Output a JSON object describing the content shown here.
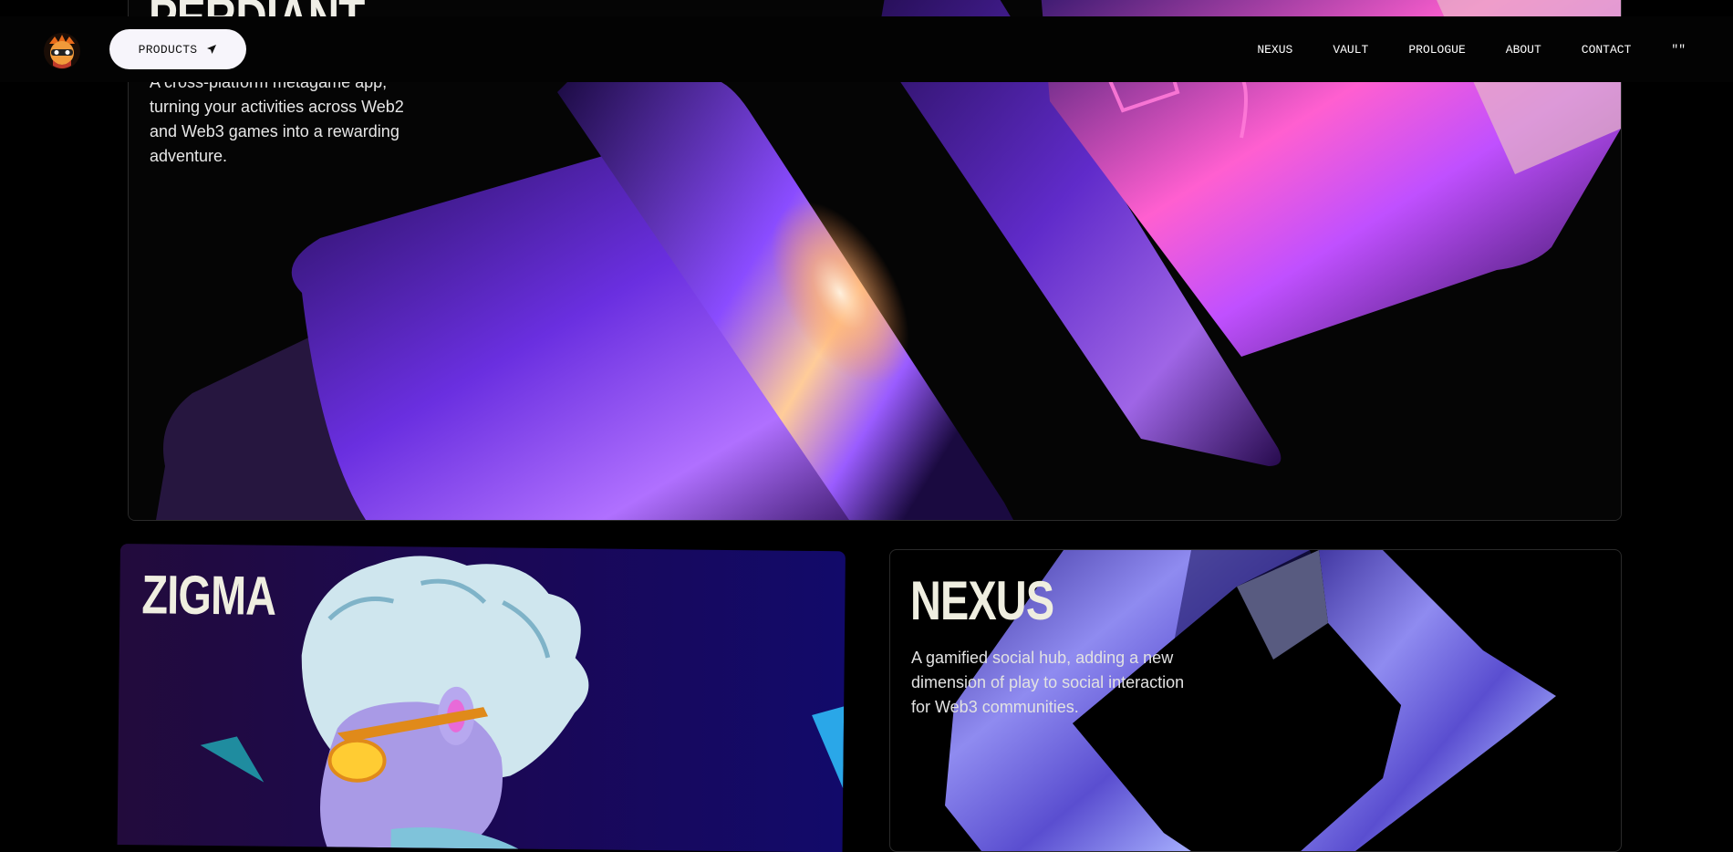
{
  "navbar": {
    "logo_icon": "ninja-mascot-icon",
    "products_label": "PRODUCTS",
    "products_icon": "paper-plane-icon",
    "links": [
      "NEXUS",
      "VAULT",
      "PROLOGUE",
      "ABOUT",
      "CONTACT",
      "\"\""
    ]
  },
  "cards": {
    "top": {
      "title": "PERDIANT",
      "description": "A cross-platform metagame app, turning your activities across Web2 and Web3 games into a rewarding adventure."
    },
    "zigma": {
      "title": "ZIGMA"
    },
    "nexus": {
      "title": "NEXUS",
      "description": "A gamified social hub, adding a new dimension of play to social interaction for Web3 communities."
    }
  },
  "colors": {
    "background": "#000000",
    "accent_purple": "#7b3cff",
    "nav_button_bg": "#f7f5fb"
  }
}
